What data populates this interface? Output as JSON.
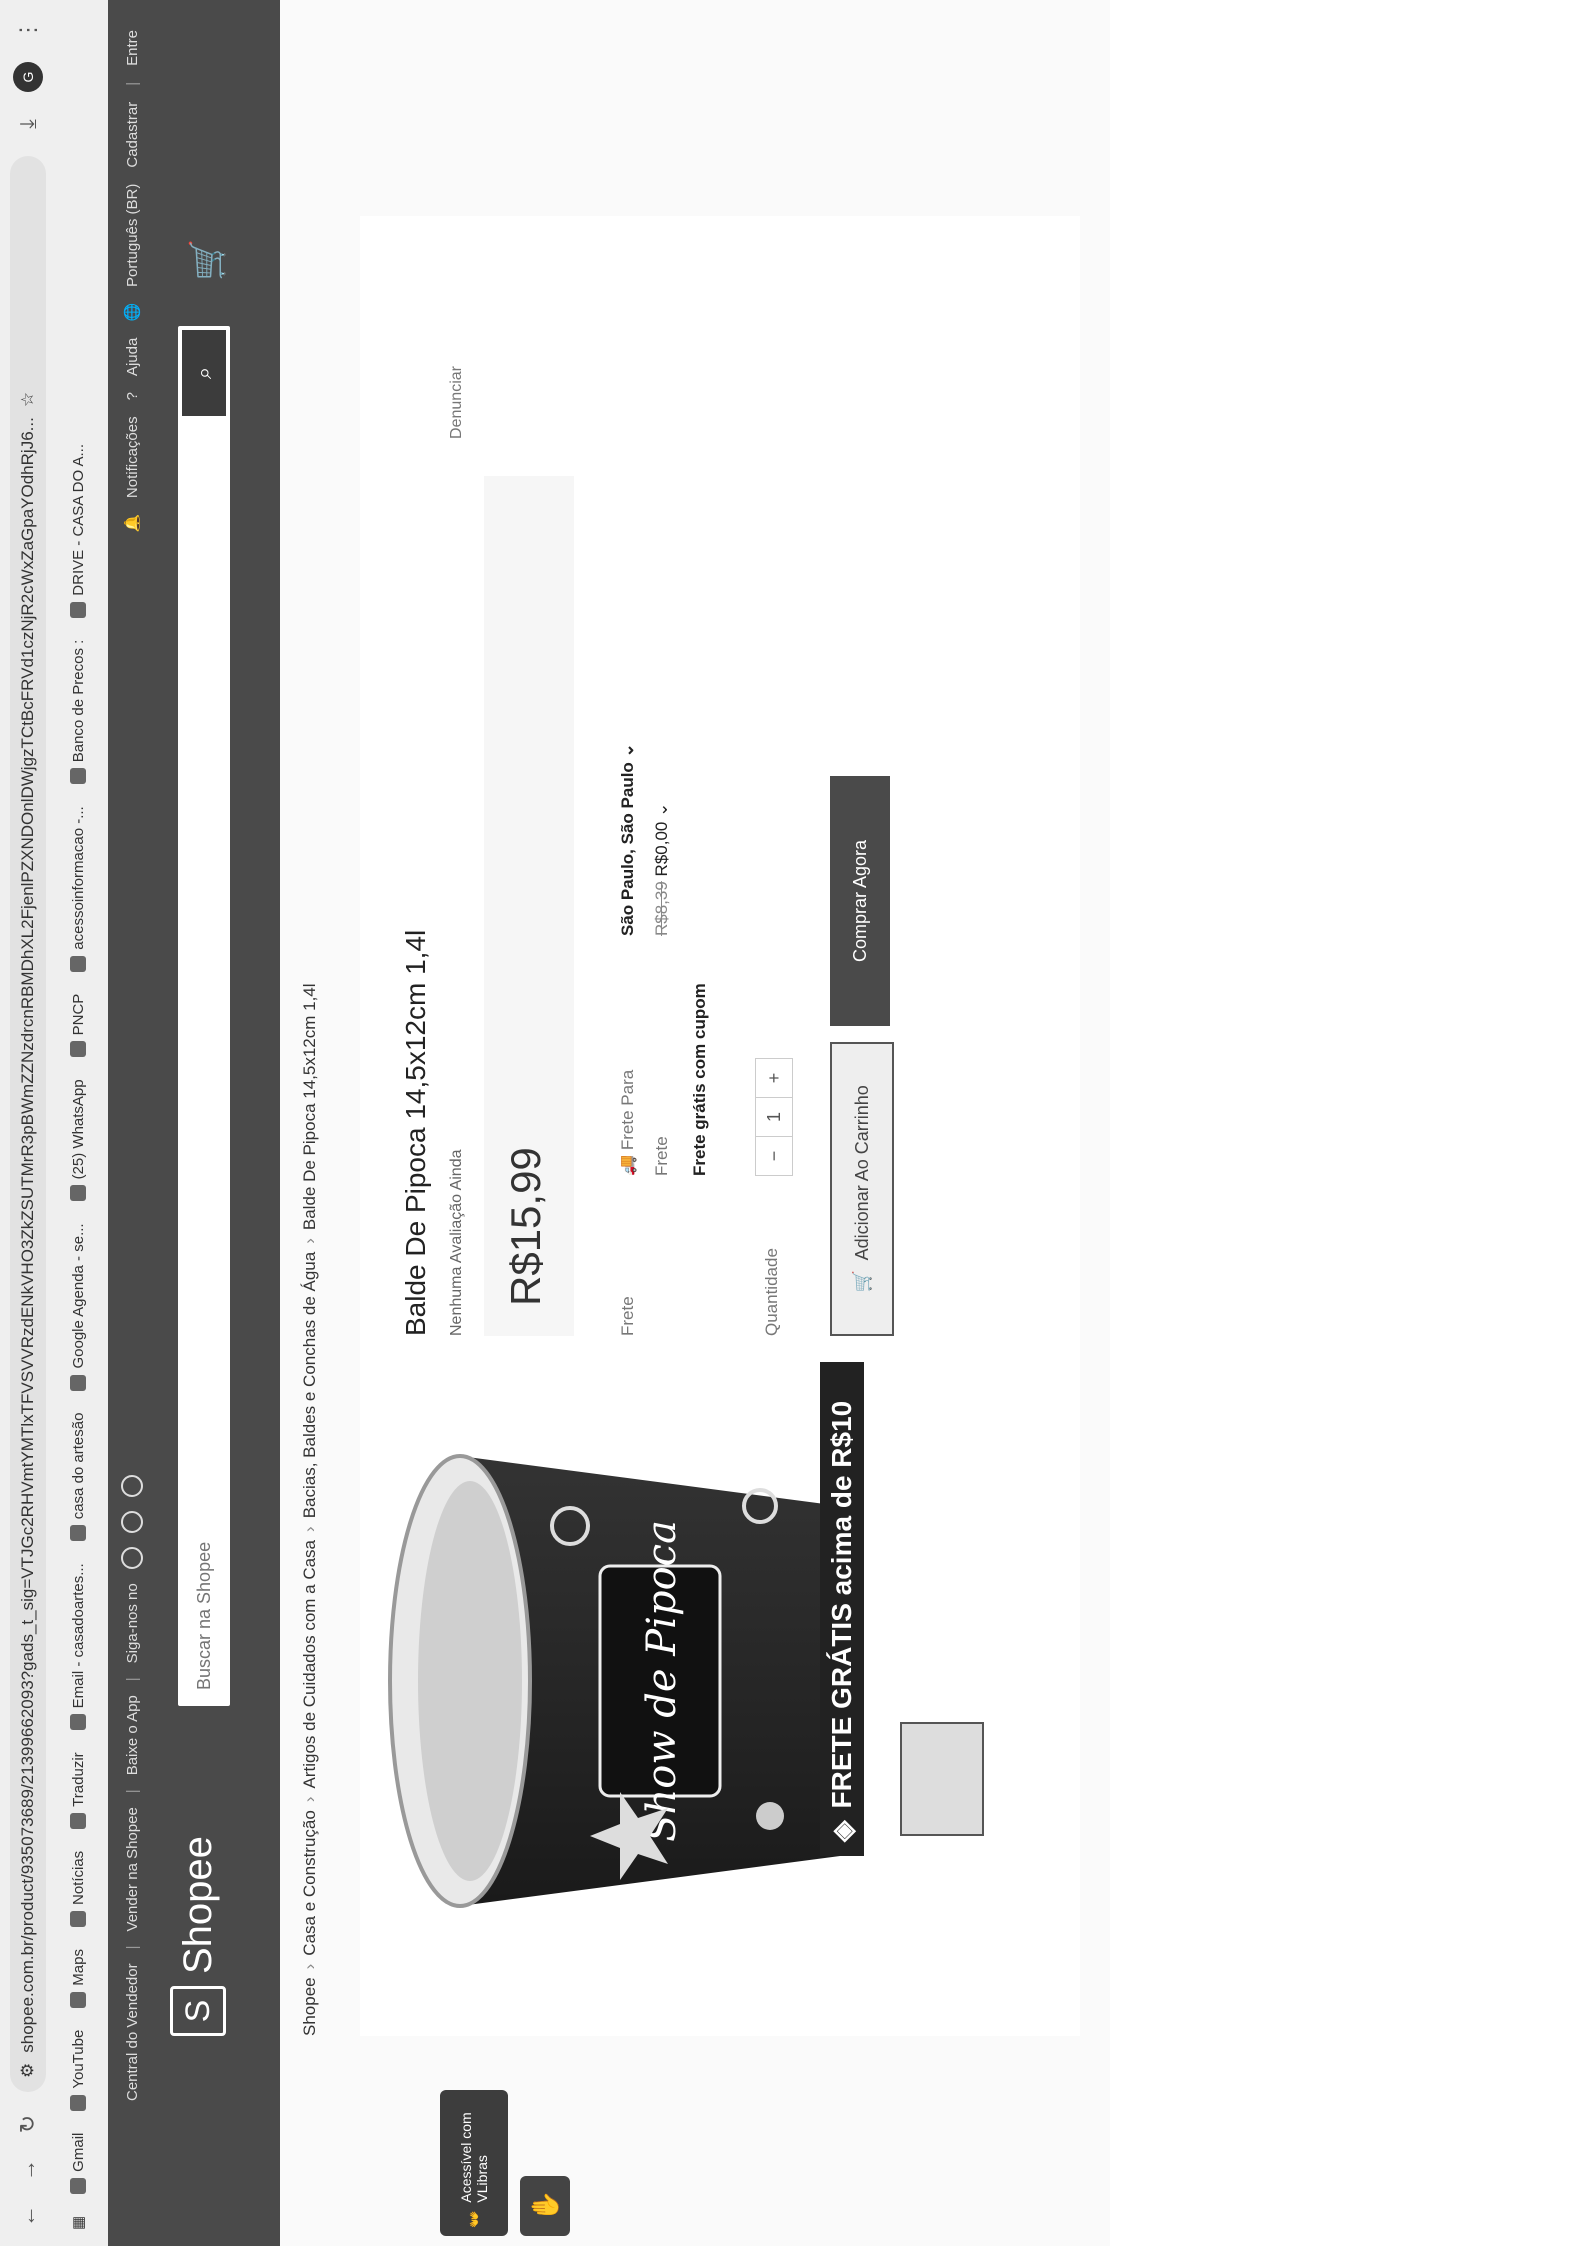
{
  "browser": {
    "url": "shopee.com.br/product/935073689/21399662093?gads_t_sig=VTJGc2RHVmtYMTlxTFVSVVRzdENkVHO3ZkZSUTMrR3pBWmZZNzdrcnRBMDhXL2FjenlPZXNDOnlDWjgzTCtBcFRVd1czNjR2cWxZaGpaYOdhRjJ6...",
    "avatar": "G",
    "bookmarks": [
      "Gmail",
      "YouTube",
      "Maps",
      "Notícias",
      "Traduzir",
      "Email - casadoartes...",
      "casa do artesão",
      "Google Agenda - se...",
      "(25) WhatsApp",
      "PNCP",
      "acessoinformacao -...",
      "Banco de Precos :",
      "DRIVE - CASA DO A..."
    ]
  },
  "header": {
    "seller_center": "Central do Vendedor",
    "sell": "Vender na Shopee",
    "app": "Baixe o App",
    "follow": "Siga-nos no",
    "notifications": "Notificações",
    "help": "Ajuda",
    "language": "Português (BR)",
    "signup": "Cadastrar",
    "login": "Entre",
    "logo": "Shopee",
    "search_placeholder": "Buscar na Shopee"
  },
  "breadcrumb": [
    "Shopee",
    "Casa e Construção",
    "Artigos de Cuidados com a Casa",
    "Bacias, Baldes e Conchas de Água",
    "Balde De Pipoca 14,5x12cm 1,4l"
  ],
  "accessibility": {
    "vlibras": "Acessível com VLibras"
  },
  "product": {
    "banner": "FRETE GRÁTIS acima de R$10",
    "title": "Balde De Pipoca 14,5x12cm 1,4l",
    "rating": "Nenhuma Avaliação Ainda",
    "report": "Denunciar",
    "price": "R$15,99",
    "shipping_label": "Frete",
    "ship_to_label": "Frete Para",
    "ship_to_value": "São Paulo, São Paulo",
    "freight_label": "Frete",
    "freight_old": "R$8,39",
    "freight_new": "R$0,00",
    "free_coupon": "Frete grátis com cupom",
    "quantity_label": "Quantidade",
    "quantity": "1",
    "add_to_cart": "Adicionar Ao Carrinho",
    "buy_now": "Comprar Agora",
    "image_text": "Show de Pipoca"
  }
}
